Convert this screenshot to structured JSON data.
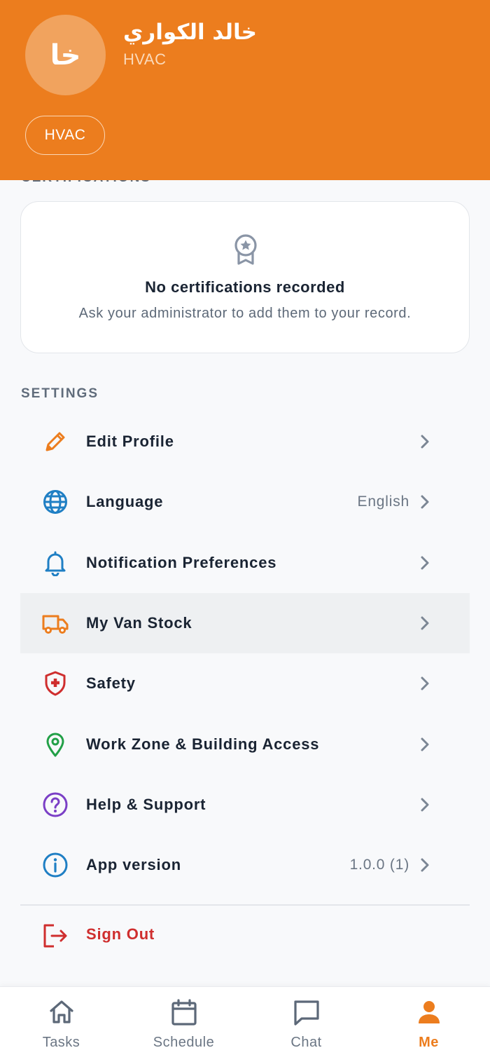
{
  "profile": {
    "avatar_initials": "خا",
    "name": "خالد الكواري",
    "role": "HVAC",
    "chip": "HVAC"
  },
  "certifications": {
    "section_label": "CERTIFICATIONS",
    "empty_title": "No certifications recorded",
    "empty_subtitle": "Ask your administrator to add them to your record."
  },
  "settings": {
    "section_label": "SETTINGS",
    "items": [
      {
        "label": "Edit Profile",
        "value": "",
        "icon": "pencil-icon"
      },
      {
        "label": "Language",
        "value": "English",
        "icon": "globe-icon"
      },
      {
        "label": "Notification Preferences",
        "value": "",
        "icon": "bell-icon"
      },
      {
        "label": "My Van Stock",
        "value": "",
        "icon": "truck-icon"
      },
      {
        "label": "Safety",
        "value": "",
        "icon": "shield-medical-icon"
      },
      {
        "label": "Work Zone & Building Access",
        "value": "",
        "icon": "map-pin-icon"
      },
      {
        "label": "Help & Support",
        "value": "",
        "icon": "help-circle-icon"
      },
      {
        "label": "App version",
        "value": "1.0.0 (1)",
        "icon": "info-icon"
      }
    ],
    "sign_out": "Sign Out"
  },
  "tabs": [
    {
      "label": "Tasks",
      "icon": "home-icon",
      "active": false
    },
    {
      "label": "Schedule",
      "icon": "calendar-icon",
      "active": false
    },
    {
      "label": "Chat",
      "icon": "chat-icon",
      "active": false
    },
    {
      "label": "Me",
      "icon": "person-icon",
      "active": true
    }
  ],
  "colors": {
    "brand": "#ec7d1e",
    "danger": "#cf2e2e",
    "text": "#1a2433",
    "muted": "#6b7684"
  }
}
